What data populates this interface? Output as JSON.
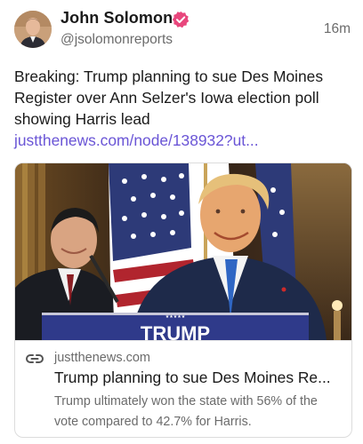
{
  "author": {
    "name": "John Solomon",
    "handle": "@jsolomonreports",
    "avatar_icon": "user-avatar",
    "verified_icon": "verified-badge-icon"
  },
  "post": {
    "timestamp": "16m",
    "text": "Breaking: Trump planning to sue Des Moines Register over Ann Selzer's Iowa election poll showing Harris lead ",
    "link_text": "justthenews.com/node/138932?ut..."
  },
  "card": {
    "image_sign_text": "TRUMP",
    "domain": "justthenews.com",
    "title": "Trump planning to sue Des Moines Re...",
    "description": "Trump ultimately won the state with 56% of the vote compared to 42.7% for Harris.",
    "link_icon": "link-chain-icon"
  },
  "colors": {
    "link": "#6a55d6",
    "badge": "#e8467c",
    "text": "#1a1a1a",
    "muted": "#6b6b6b"
  }
}
